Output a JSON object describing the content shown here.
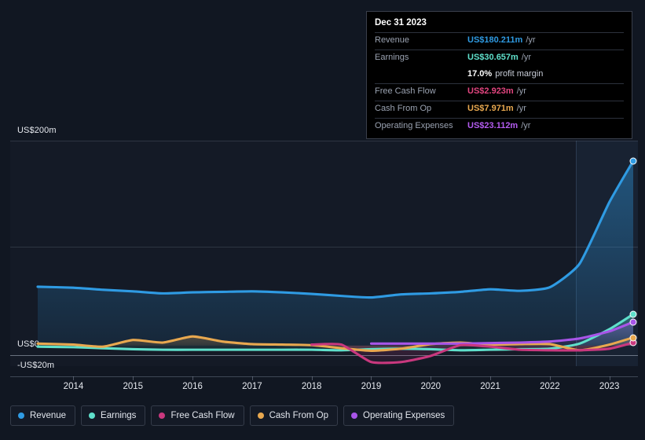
{
  "chart_data": {
    "type": "line",
    "title": "",
    "xlabel": "",
    "ylabel": "",
    "ylim": [
      -20,
      200
    ],
    "y_unit": "US$m",
    "grid": true,
    "legend_position": "bottom",
    "y_ticks": [
      {
        "label": "US$200m",
        "value": 200
      },
      {
        "label": "US$0",
        "value": 0
      },
      {
        "label": "-US$20m",
        "value": -20
      }
    ],
    "x_ticks": [
      "2014",
      "2015",
      "2016",
      "2017",
      "2018",
      "2019",
      "2020",
      "2021",
      "2022",
      "2023"
    ],
    "x": [
      2013.4,
      2014,
      2014.5,
      2015,
      2015.5,
      2016,
      2016.5,
      2017,
      2017.5,
      2018,
      2018.5,
      2019,
      2019.5,
      2020,
      2020.5,
      2021,
      2021.5,
      2022,
      2022.5,
      2023,
      2023.4
    ],
    "series": [
      {
        "name": "Revenue",
        "color": "#2f9be3",
        "values": [
          57.5,
          56.5,
          54.5,
          53.0,
          51.0,
          52.0,
          52.5,
          53.0,
          52.0,
          50.5,
          48.5,
          47.0,
          50.0,
          51.0,
          52.5,
          55.0,
          53.5,
          57.0,
          80.0,
          140.0,
          180.211
        ],
        "end_value": 180.211,
        "end_label": "US$180.211m"
      },
      {
        "name": "Earnings",
        "color": "#5fe0cb",
        "values": [
          -1.0,
          -1.5,
          -2.5,
          -3.5,
          -4.0,
          -4.0,
          -4.0,
          -4.0,
          -4.0,
          -4.0,
          -4.5,
          -3.5,
          -3.0,
          -3.5,
          -4.5,
          -4.0,
          -3.5,
          -3.0,
          2.0,
          16.0,
          30.657
        ],
        "end_value": 30.657,
        "end_label": "US$30.657m"
      },
      {
        "name": "Free Cash Flow",
        "color": "#c9387e",
        "start_x": 2018,
        "values": [
          null,
          null,
          null,
          null,
          null,
          null,
          null,
          null,
          null,
          1.0,
          1.0,
          -16.0,
          -16.0,
          -10.0,
          0.5,
          -1.0,
          -4.0,
          -4.5,
          -4.5,
          -3.0,
          2.923
        ],
        "end_value": 2.923,
        "end_label": "US$2.923m"
      },
      {
        "name": "Cash From Op",
        "color": "#e8a84f",
        "values": [
          2.0,
          1.0,
          -1.0,
          5.5,
          3.0,
          9.0,
          4.0,
          1.5,
          1.0,
          0.5,
          -2.5,
          -5.0,
          -3.0,
          1.5,
          3.0,
          1.0,
          1.5,
          1.5,
          -4.5,
          1.0,
          7.971
        ],
        "end_value": 7.971,
        "end_label": "US$7.971m"
      },
      {
        "name": "Operating Expenses",
        "color": "#a855e8",
        "start_x": 2019,
        "values": [
          null,
          null,
          null,
          null,
          null,
          null,
          null,
          null,
          null,
          null,
          null,
          2.0,
          2.0,
          2.0,
          2.0,
          2.5,
          3.0,
          4.0,
          7.0,
          14.0,
          23.112
        ],
        "end_value": 23.112,
        "end_label": "US$23.112m"
      }
    ]
  },
  "tooltip": {
    "date": "Dec 31 2023",
    "rows": [
      {
        "key": "Revenue",
        "value": "US$180.211m",
        "unit": "/yr",
        "color": "#2f9be3"
      },
      {
        "key": "Earnings",
        "value": "US$30.657m",
        "unit": "/yr",
        "color": "#5fe0cb"
      },
      {
        "key": "",
        "value": "17.0%",
        "sub": "profit margin",
        "color": "#ffffff"
      },
      {
        "key": "Free Cash Flow",
        "value": "US$2.923m",
        "unit": "/yr",
        "color": "#e2457f"
      },
      {
        "key": "Cash From Op",
        "value": "US$7.971m",
        "unit": "/yr",
        "color": "#e8a84f"
      },
      {
        "key": "Operating Expenses",
        "value": "US$23.112m",
        "unit": "/yr",
        "color": "#b45cf0"
      }
    ]
  },
  "legend": {
    "items": [
      {
        "label": "Revenue",
        "color": "#2f9be3"
      },
      {
        "label": "Earnings",
        "color": "#5fe0cb"
      },
      {
        "label": "Free Cash Flow",
        "color": "#c9387e"
      },
      {
        "label": "Cash From Op",
        "color": "#e8a84f"
      },
      {
        "label": "Operating Expenses",
        "color": "#a855e8"
      }
    ]
  }
}
